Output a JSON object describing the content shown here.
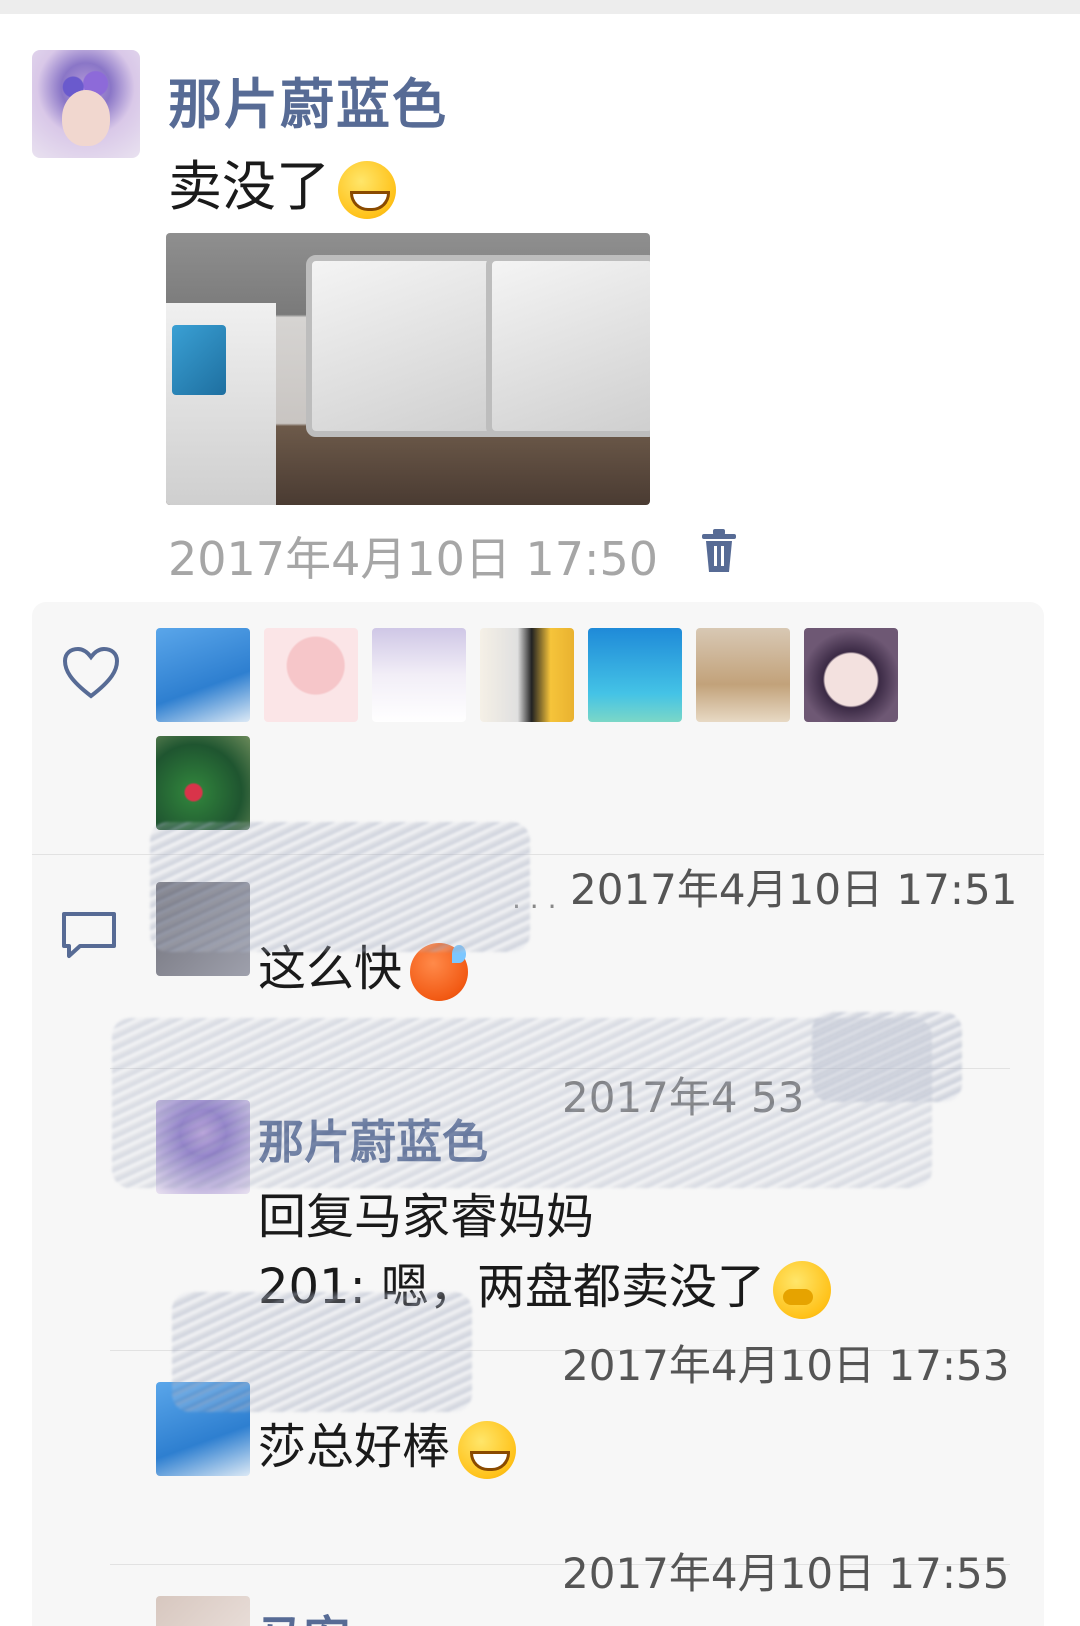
{
  "post": {
    "author": "那片蔚蓝色",
    "text": "卖没了",
    "time": "2017年4月10日 17:50"
  },
  "likes": {
    "icon": "heart-icon",
    "count_avatars": 8
  },
  "comments": [
    {
      "author": "",
      "time": "2017年4月10日 17:51",
      "text": "这么快"
    },
    {
      "author": "那片蔚蓝色",
      "time": "2017年4 53",
      "text_line1": "回复马家睿妈妈",
      "text_line2": "201: 嗯，两盘都卖没了"
    },
    {
      "author": "",
      "time": "2017年4月10日 17:53",
      "text": "莎总好棒"
    },
    {
      "author": "马宏",
      "time": "2017年4月10日 17:55"
    }
  ],
  "colors": {
    "name_blue": "#576b95",
    "time_gray": "#a6a6a6",
    "panel_bg": "#f7f7f7"
  }
}
